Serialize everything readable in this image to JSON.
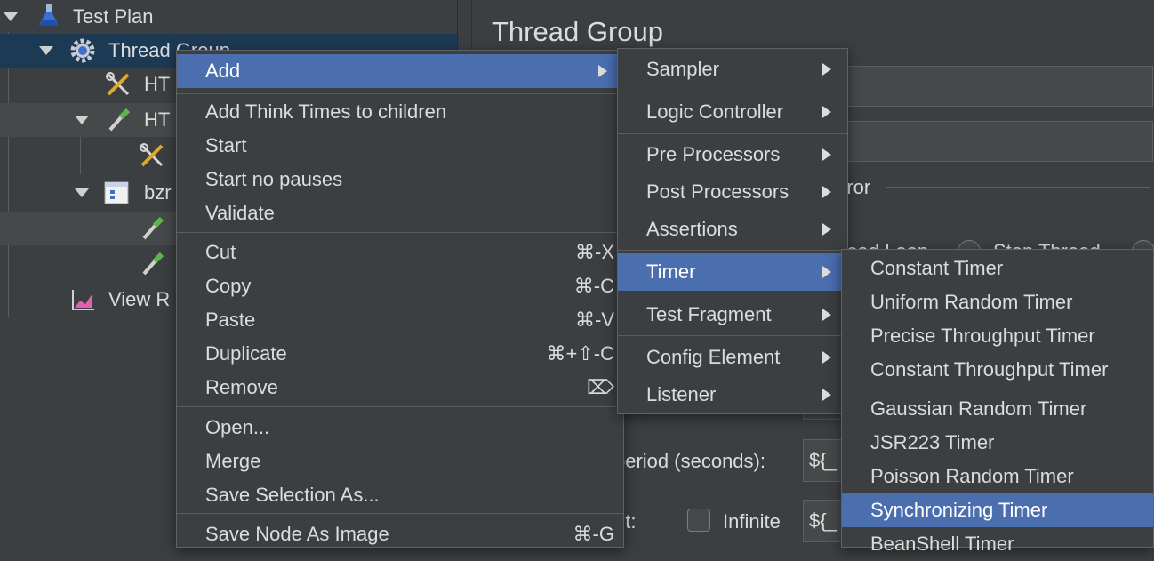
{
  "tree": {
    "items": [
      {
        "label": "Test Plan",
        "icon": "flask-icon"
      },
      {
        "label": "Thread Group",
        "icon": "gear-icon"
      },
      {
        "label": "HT",
        "icon": "wrench-screwdriver-icon"
      },
      {
        "label": "HT",
        "icon": "pipette-icon"
      },
      {
        "label": "",
        "icon": "wrench-screwdriver-icon"
      },
      {
        "label": "bzr",
        "icon": "module-icon"
      },
      {
        "label": "",
        "icon": "pipette-icon"
      },
      {
        "label": "",
        "icon": "pipette-icon"
      },
      {
        "label": "View R",
        "icon": "chart-icon"
      }
    ]
  },
  "panel": {
    "title": "Thread Group",
    "error_fragment": "rror",
    "radio_fragment_1": "read Loop",
    "radio_fragment_2": "Stop Thread",
    "rampup_label": "period (seconds):",
    "rampup_value": "${_",
    "loop_label": "nt:",
    "infinite_label": "Infinite",
    "loop_value": "${_"
  },
  "context_menu": {
    "items": [
      {
        "label": "Add",
        "highlighted": true,
        "submenu": true
      },
      {
        "label": "Add Think Times to children"
      },
      {
        "label": "Start"
      },
      {
        "label": "Start no pauses"
      },
      {
        "label": "Validate"
      },
      {
        "label": "Cut",
        "shortcut": "⌘-X"
      },
      {
        "label": "Copy",
        "shortcut": "⌘-C"
      },
      {
        "label": "Paste",
        "shortcut": "⌘-V"
      },
      {
        "label": "Duplicate",
        "shortcut": "⌘+⇧-C"
      },
      {
        "label": "Remove",
        "shortcut": "⌦"
      },
      {
        "label": "Open..."
      },
      {
        "label": "Merge"
      },
      {
        "label": "Save Selection As..."
      },
      {
        "label": "Save Node As Image",
        "shortcut": "⌘-G"
      }
    ]
  },
  "add_submenu": {
    "items": [
      {
        "label": "Sampler"
      },
      {
        "label": "Logic Controller"
      },
      {
        "label": "Pre Processors"
      },
      {
        "label": "Post Processors"
      },
      {
        "label": "Assertions"
      },
      {
        "label": "Timer",
        "highlighted": true
      },
      {
        "label": "Test Fragment"
      },
      {
        "label": "Config Element"
      },
      {
        "label": "Listener"
      }
    ]
  },
  "timer_submenu": {
    "items": [
      {
        "label": "Constant Timer"
      },
      {
        "label": "Uniform Random Timer"
      },
      {
        "label": "Precise Throughput Timer"
      },
      {
        "label": "Constant Throughput Timer"
      },
      {
        "label": "Gaussian Random Timer"
      },
      {
        "label": "JSR223 Timer"
      },
      {
        "label": "Poisson Random Timer"
      },
      {
        "label": "Synchronizing Timer",
        "highlighted": true
      },
      {
        "label": "BeanShell Timer"
      }
    ]
  },
  "colors": {
    "background": "#3c3f41",
    "selection": "#1d3a55",
    "menu_highlight": "#4b6eaf"
  }
}
